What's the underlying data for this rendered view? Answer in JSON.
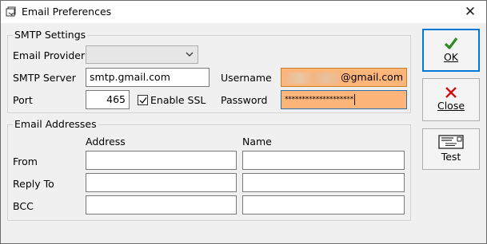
{
  "window": {
    "title": "Email Preferences",
    "close_glyph": "✕"
  },
  "smtp": {
    "group_title": "SMTP Settings",
    "provider_label": "Email Provider",
    "provider_value": "",
    "server_label": "SMTP Server",
    "server_value": "smtp.gmail.com",
    "port_label": "Port",
    "port_value": "465",
    "ssl_label": "Enable SSL",
    "ssl_checked": true,
    "username_label": "Username",
    "username_suffix": "@gmail.com",
    "password_label": "Password",
    "password_value": "********************",
    "highlight_color": "#fdb57a"
  },
  "addresses": {
    "group_title": "Email Addresses",
    "col_address": "Address",
    "col_name": "Name",
    "rows": [
      {
        "label": "From",
        "address": "",
        "name": ""
      },
      {
        "label": "Reply To",
        "address": "",
        "name": ""
      },
      {
        "label": "BCC",
        "address": "",
        "name": ""
      }
    ]
  },
  "buttons": {
    "ok_label": "OK",
    "close_label": "Close",
    "test_label": "Test",
    "ok_icon": "checkmark-icon",
    "close_icon": "red-x-icon",
    "test_icon": "envelope-icon",
    "ok_color": "#2e8b20",
    "close_color": "#d01010"
  }
}
